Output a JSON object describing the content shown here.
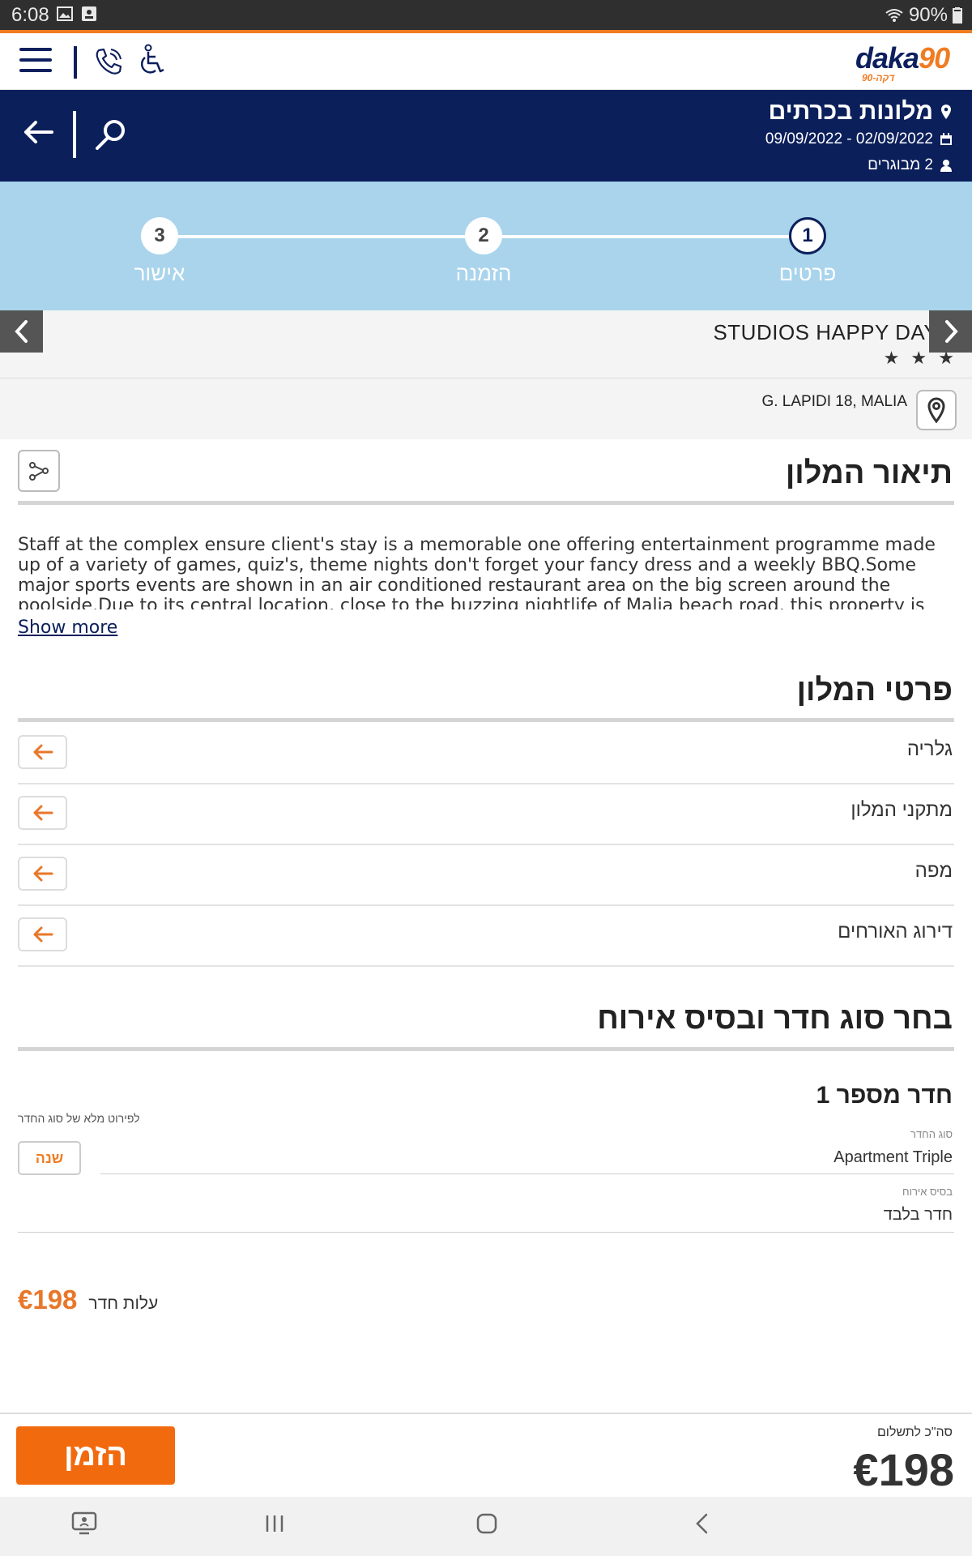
{
  "status_bar": {
    "time": "6:08",
    "battery": "90%"
  },
  "header": {
    "title": "מלונות בכרתים",
    "dates": "02/09/2022 - 09/09/2022",
    "guests": "2 מבוגרים"
  },
  "logo": {
    "brand": "daka",
    "number": "90",
    "tagline": "דקה-90"
  },
  "steps": [
    {
      "number": "1",
      "label": "פרטים"
    },
    {
      "number": "2",
      "label": "הזמנה"
    },
    {
      "number": "3",
      "label": "אישור"
    }
  ],
  "hotel": {
    "name": "STUDIOS HAPPY DAYS",
    "stars": "★ ★ ★",
    "address": "G. LAPIDI 18, MALIA"
  },
  "description": {
    "title": "תיאור המלון",
    "text": "Staff at the complex ensure client's stay is a memorable one offering entertainment programme made up of a variety of games, quiz's, theme nights don't forget your fancy dress and a weekly BBQ.Some major sports events are shown in an air conditioned restaurant area on the big screen around the poolside.Due to its central location, close to the buzzing nightlife of Malia beach road, this property is popular amongst young",
    "show_more": "Show more"
  },
  "details": {
    "title": "פרטי המלון",
    "items": [
      {
        "label": "גלריה"
      },
      {
        "label": "מתקני המלון"
      },
      {
        "label": "מפה"
      },
      {
        "label": "דירוג האורחים"
      }
    ]
  },
  "room_section": {
    "title": "בחר סוג חדר ובסיס אירוח",
    "room_title": "חדר מספר 1",
    "full_details_note": "לפירוט מלא של סוג החדר",
    "change_label": "שנה",
    "room_type_label": "סוג החדר",
    "room_type_value": "Apartment Triple",
    "board_label": "בסיס אירוח",
    "board_value": "חדר בלבד",
    "cost_label": "עלות חדר",
    "cost_value": "€198"
  },
  "footer": {
    "book_label": "הזמן",
    "total_label": "סה\"כ לתשלום",
    "total_value": "€198"
  },
  "colors": {
    "navy": "#0b1f5b",
    "orange": "#f26a0e",
    "light_blue": "#a9d4ec"
  }
}
